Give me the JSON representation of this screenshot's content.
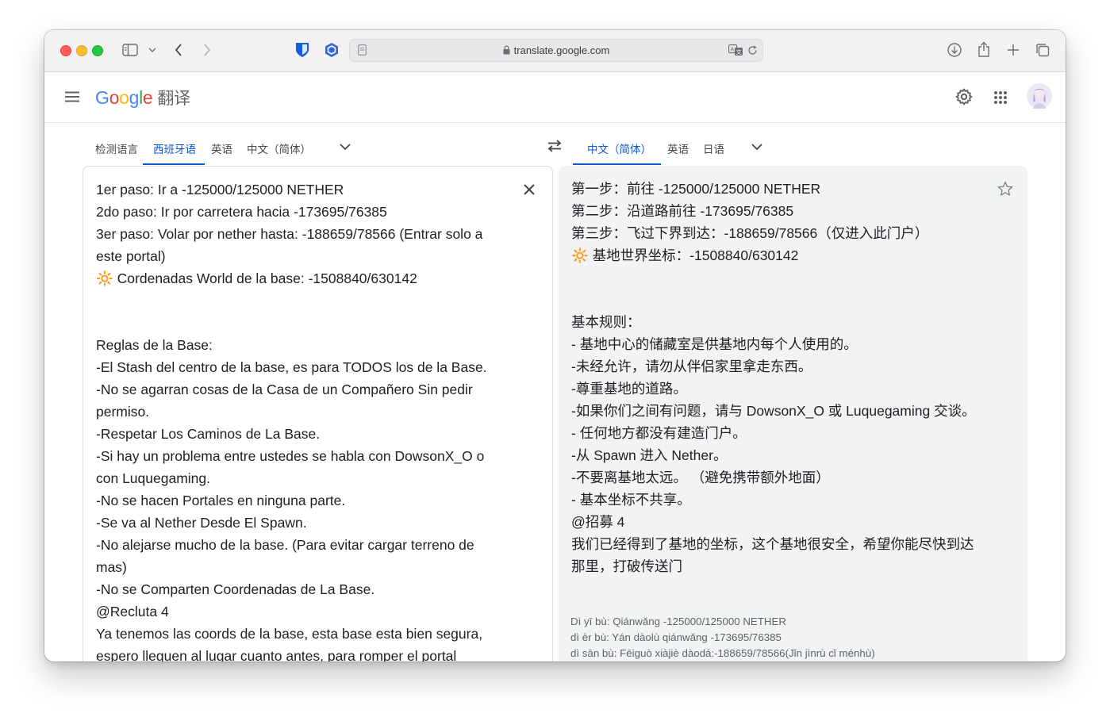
{
  "browser": {
    "url": "translate.google.com"
  },
  "header": {
    "logo_letters": [
      "G",
      "o",
      "o",
      "g",
      "l",
      "e"
    ],
    "product": "翻译"
  },
  "source_langs": {
    "tabs": [
      "检测语言",
      "西班牙语",
      "英语",
      "中文（简体）"
    ],
    "active_index": 1
  },
  "target_langs": {
    "tabs": [
      "中文（简体）",
      "英语",
      "日语"
    ],
    "active_index": 0
  },
  "source_text": {
    "lines": [
      "1er paso: Ir a -125000/125000 NETHER",
      "2do paso: Ir por carretera hacia -173695/76385",
      "3er paso: Volar por nether hasta: -188659/78566 (Entrar solo a",
      "este portal)",
      "🔆 Cordenadas World de la base: -1508840/630142",
      "",
      "",
      "Reglas de la Base:",
      "-El Stash del centro de la base, es para TODOS los de la Base.",
      "-No se agarran cosas de la Casa de un Compañero Sin pedir",
      "permiso.",
      "-Respetar Los Caminos de La Base.",
      "-Si hay un problema entre ustedes se habla con DowsonX_O o",
      "con Luquegaming.",
      "-No se hacen Portales en ninguna parte.",
      "-Se va al Nether Desde El Spawn.",
      "-No alejarse mucho de la base. (Para evitar cargar terreno de",
      "mas)",
      "-No se Comparten Coordenadas de La Base.",
      "@Recluta 4",
      "Ya tenemos las coords de la base, esta base esta bien segura,",
      "espero lleguen al lugar cuanto antes, para romper el portal"
    ]
  },
  "translation": {
    "lines": [
      "第一步：前往 -125000/125000 NETHER",
      "第二步：沿道路前往 -173695/76385",
      "第三步：飞过下界到达：-188659/78566（仅进入此门户）",
      "🔆 基地世界坐标：-1508840/630142",
      "",
      "",
      "基本规则：",
      "- 基地中心的储藏室是供基地内每个人使用的。",
      "-未经允许，请勿从伴侣家里拿走东西。",
      "-尊重基地的道路。",
      "-如果你们之间有问题，请与 DowsonX_O 或 Luquegaming 交谈。",
      "- 任何地方都没有建造门户。",
      "-从 Spawn 进入 Nether。",
      "-不要离基地太远。 （避免携带额外地面）",
      "- 基本坐标不共享。",
      "@招募 4",
      "我们已经得到了基地的坐标，这个基地很安全，希望你能尽快到达",
      "那里，打破传送门"
    ],
    "romanization": [
      "Dì yī bù: Qiánwǎng -125000/125000 NETHER",
      "dì èr bù: Yán dàolù qiánwǎng -173695/76385",
      "dì sān bù: Fēiguò xiàjiè dàodá:-188659/78566(Jǐn jìnrù cǐ ménhù)"
    ]
  },
  "colors": {
    "accent": "#0b57d0",
    "target_bg": "#f1f3f4"
  }
}
